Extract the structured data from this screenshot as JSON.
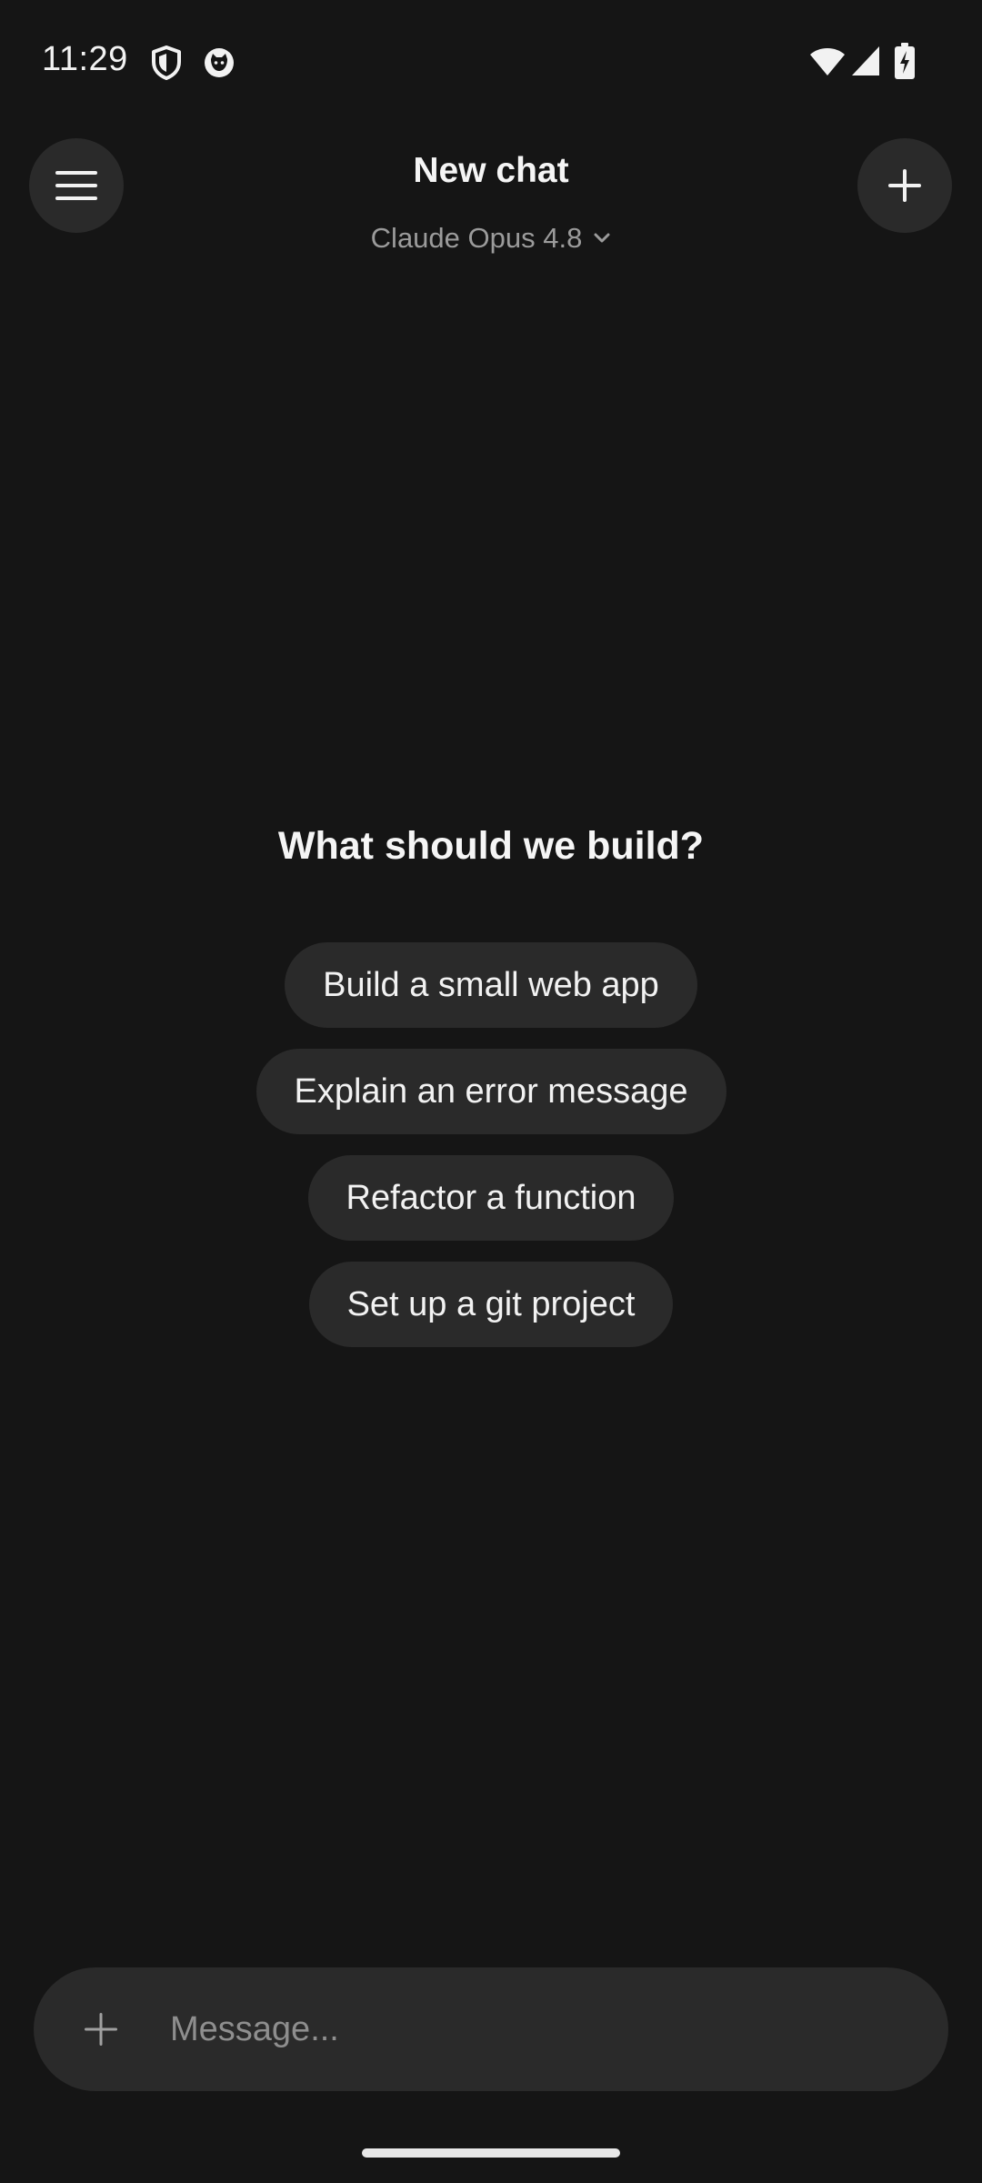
{
  "status_bar": {
    "time": "11:29",
    "left_icons": [
      "shield-icon",
      "cat-face-icon"
    ],
    "right_icons": [
      "wifi-icon",
      "cell-signal-icon",
      "battery-charging-icon"
    ]
  },
  "header": {
    "title": "New chat",
    "model_label": "Claude Opus 4.8",
    "menu_icon": "hamburger-menu-icon",
    "new_chat_icon": "plus-icon"
  },
  "main": {
    "heading": "What should we build?",
    "suggestions": [
      {
        "label": "Build a small web app"
      },
      {
        "label": "Explain an error message"
      },
      {
        "label": "Refactor a function"
      },
      {
        "label": "Set up a git project"
      }
    ]
  },
  "composer": {
    "placeholder": "Message...",
    "value": "",
    "attach_icon": "plus-icon"
  },
  "colors": {
    "background": "#151515",
    "surface": "#2a2a2a",
    "text_primary": "#f5f5f5",
    "text_secondary": "#9b9b9b"
  }
}
